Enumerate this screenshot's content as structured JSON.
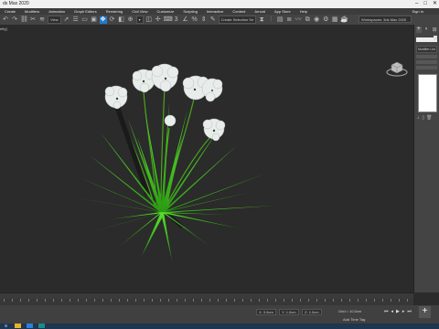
{
  "titlebar": {
    "title": "ds Max 2020",
    "min": "–",
    "max": "□",
    "close": "✕"
  },
  "menus": [
    "Create",
    "Modifiers",
    "Animation",
    "Graph Editors",
    "Rendering",
    "Civil View",
    "Customize",
    "Scripting",
    "Interactive",
    "Content",
    "Arnold",
    "App Store",
    "Help"
  ],
  "signin": "Sign In",
  "toolbar": {
    "filter": "View",
    "selection_set": "Create Selection Se",
    "workspace": "Workspaces: 3ds Max 2020"
  },
  "viewport": {
    "label": "efty]"
  },
  "command_panel": {
    "modifier_list": "Modifier List"
  },
  "status": {
    "x_label": "X:",
    "x_value": "3.6cm",
    "y_label": "Y:",
    "y_value": "1.0cm",
    "z_label": "Z:",
    "z_value": "1.0cm",
    "grid": "Grid = 10.0cm",
    "add_time_tag": "Add Time Tag"
  },
  "colors": {
    "selected_tool": "#1e7bd0",
    "grass": "#39c21a",
    "flower": "#e8ecea"
  }
}
